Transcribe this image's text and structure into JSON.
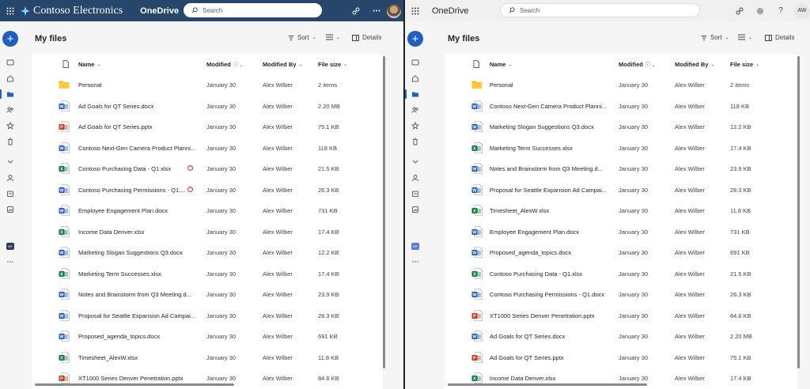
{
  "left": {
    "brand": "Contoso Electronics",
    "app": "OneDrive",
    "search_placeholder": "Search",
    "page_title": "My files",
    "sort_label": "Sort",
    "details_label": "Details",
    "columns": {
      "name": "Name",
      "modified": "Modified",
      "modified_by": "Modified By",
      "file_size": "File size"
    },
    "files": [
      {
        "name": "Personal",
        "type": "folder",
        "modified": "January 30",
        "by": "Alex Wilber",
        "size": "2 items"
      },
      {
        "name": "Ad Goals for QT Series.docx",
        "type": "word",
        "modified": "January 30",
        "by": "Alex Wilber",
        "size": "2.20 MB"
      },
      {
        "name": "Ad Goals for QT Series.pptx",
        "type": "ppt",
        "modified": "January 30",
        "by": "Alex Wilber",
        "size": "75.1 KB"
      },
      {
        "name": "Contoso Next-Gen Camera Product Planni...",
        "type": "word",
        "modified": "January 30",
        "by": "Alex Wilber",
        "size": "118 KB"
      },
      {
        "name": "Contoso Purchasing Data - Q1.xlsx",
        "type": "excel",
        "modified": "January 30",
        "by": "Alex Wilber",
        "size": "21.5 KB",
        "status": true
      },
      {
        "name": "Contoso Purchasing Permissions - Q1....",
        "type": "word",
        "modified": "January 30",
        "by": "Alex Wilber",
        "size": "26.3 KB",
        "status": true
      },
      {
        "name": "Employee Engagement Plan.docx",
        "type": "word",
        "modified": "January 30",
        "by": "Alex Wilber",
        "size": "731 KB"
      },
      {
        "name": "Income Data Denver.xlsx",
        "type": "excel",
        "modified": "January 30",
        "by": "Alex Wilber",
        "size": "17.4 KB"
      },
      {
        "name": "Marketing Slogan Suggestions Q3.docx",
        "type": "word",
        "modified": "January 30",
        "by": "Alex Wilber",
        "size": "12.2 KB"
      },
      {
        "name": "Marketing Term Successes.xlsx",
        "type": "excel",
        "modified": "January 30",
        "by": "Alex Wilber",
        "size": "17.4 KB"
      },
      {
        "name": "Notes and Brainstorm from Q3 Meeting.d...",
        "type": "word",
        "modified": "January 30",
        "by": "Alex Wilber",
        "size": "23.9 KB"
      },
      {
        "name": "Proposal for Seattle Expansion Ad Campai...",
        "type": "word",
        "modified": "January 30",
        "by": "Alex Wilber",
        "size": "28.3 KB"
      },
      {
        "name": "Proposed_agenda_topics.docx",
        "type": "word",
        "modified": "January 30",
        "by": "Alex Wilber",
        "size": "691 KB"
      },
      {
        "name": "Timesheet_AlexW.xlsx",
        "type": "excel",
        "modified": "January 30",
        "by": "Alex Wilber",
        "size": "11.8 KB"
      },
      {
        "name": "XT1000 Series Denver Penetration.pptx",
        "type": "ppt",
        "modified": "January 30",
        "by": "Alex Wilber",
        "size": "84.6 KB"
      }
    ]
  },
  "right": {
    "app": "OneDrive",
    "search_placeholder": "Search",
    "avatar_initials": "AW",
    "page_title": "My files",
    "sort_label": "Sort",
    "details_label": "Details",
    "columns": {
      "name": "Name",
      "modified": "Modified",
      "modified_by": "Modified By",
      "file_size": "File size"
    },
    "files": [
      {
        "name": "Personal",
        "type": "folder",
        "modified": "January 30",
        "by": "Alex Wilber",
        "size": "2 items"
      },
      {
        "name": "Contoso Next-Gen Camera Product Planni...",
        "type": "word",
        "modified": "January 30",
        "by": "Alex Wilber",
        "size": "118 KB"
      },
      {
        "name": "Marketing Slogan Suggestions Q3.docx",
        "type": "word",
        "modified": "January 30",
        "by": "Alex Wilber",
        "size": "12.2 KB"
      },
      {
        "name": "Marketing Term Successes.xlsx",
        "type": "excel",
        "modified": "January 30",
        "by": "Alex Wilber",
        "size": "17.4 KB"
      },
      {
        "name": "Notes and Brainstorm from Q3 Meeting.d...",
        "type": "word",
        "modified": "January 30",
        "by": "Alex Wilber",
        "size": "23.9 KB"
      },
      {
        "name": "Proposal for Seattle Expansion Ad Campai...",
        "type": "word",
        "modified": "January 30",
        "by": "Alex Wilber",
        "size": "28.3 KB"
      },
      {
        "name": "Timesheet_AlexW.xlsx",
        "type": "excel",
        "modified": "January 30",
        "by": "Alex Wilber",
        "size": "11.8 KB"
      },
      {
        "name": "Employee Engagement Plan.docx",
        "type": "word",
        "modified": "January 30",
        "by": "Alex Wilber",
        "size": "731 KB"
      },
      {
        "name": "Proposed_agenda_topics.docx",
        "type": "word",
        "modified": "January 30",
        "by": "Alex Wilber",
        "size": "691 KB"
      },
      {
        "name": "Contoso Purchasing Data - Q1.xlsx",
        "type": "excel",
        "modified": "January 30",
        "by": "Alex Wilber",
        "size": "21.5 KB"
      },
      {
        "name": "Contoso Purchasing Permissions - Q1.docx",
        "type": "word",
        "modified": "January 30",
        "by": "Alex Wilber",
        "size": "26.3 KB"
      },
      {
        "name": "XT1000 Series Denver Penetration.pptx",
        "type": "ppt",
        "modified": "January 30",
        "by": "Alex Wilber",
        "size": "84.6 KB"
      },
      {
        "name": "Ad Goals for QT Series.docx",
        "type": "word",
        "modified": "January 30",
        "by": "Alex Wilber",
        "size": "2.20 MB"
      },
      {
        "name": "Ad Goals for QT Series.pptx",
        "type": "ppt",
        "modified": "January 30",
        "by": "Alex Wilber",
        "size": "75.1 KB"
      },
      {
        "name": "Income Data Denver.xlsx",
        "type": "excel",
        "modified": "January 30",
        "by": "Alex Wilber",
        "size": "17.4 KB"
      }
    ]
  },
  "colors": {
    "brand_bar": "#26466b",
    "accent": "#1f5fbf",
    "word": "#185abd",
    "excel": "#107c41",
    "ppt": "#c43e1c",
    "folder": "#ffb900"
  }
}
